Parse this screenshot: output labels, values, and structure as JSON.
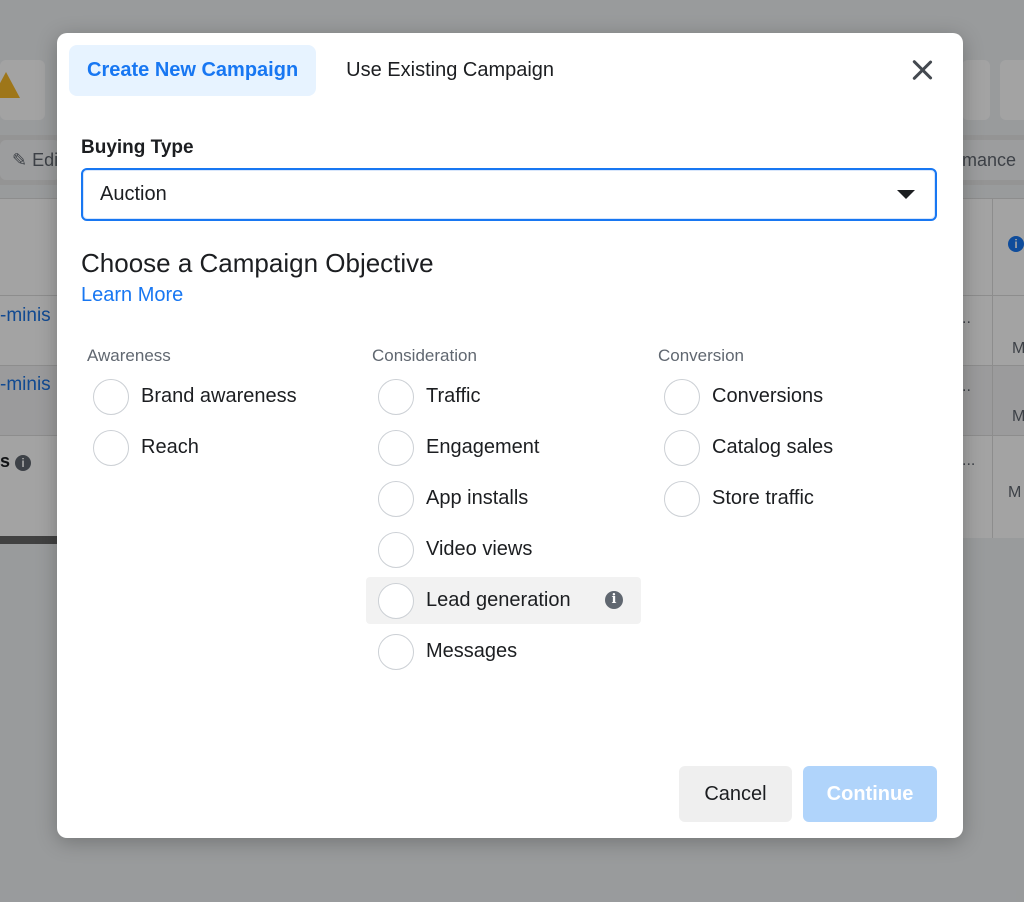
{
  "background": {
    "toolbar": {
      "edit_label": "Edit",
      "right_label": "mance"
    },
    "rows": [
      {
        "link": "-minis",
        "marker": "..",
        "small": "M"
      },
      {
        "link": "-minis",
        "marker": "..",
        "small": "M"
      },
      {
        "text": "s",
        "marker": "...",
        "small": "M"
      }
    ]
  },
  "modal": {
    "tabs": [
      {
        "label": "Create New Campaign",
        "active": true
      },
      {
        "label": "Use Existing Campaign",
        "active": false
      }
    ],
    "buying_type": {
      "label": "Buying Type",
      "value": "Auction"
    },
    "objective": {
      "title": "Choose a Campaign Objective",
      "learn_more": "Learn More"
    },
    "columns": [
      {
        "heading": "Awareness",
        "options": [
          "Brand awareness",
          "Reach"
        ]
      },
      {
        "heading": "Consideration",
        "options": [
          "Traffic",
          "Engagement",
          "App installs",
          "Video views",
          "Lead generation",
          "Messages"
        ]
      },
      {
        "heading": "Conversion",
        "options": [
          "Conversions",
          "Catalog sales",
          "Store traffic"
        ]
      }
    ],
    "buttons": {
      "cancel": "Cancel",
      "continue": "Continue"
    },
    "icons": {
      "close": "close-icon",
      "caret": "caret-down-icon",
      "info": "info-icon"
    },
    "colors": {
      "accent": "#1877f2",
      "tab_active_bg": "#e7f3ff",
      "continue_disabled": "#b0d4fb"
    }
  }
}
